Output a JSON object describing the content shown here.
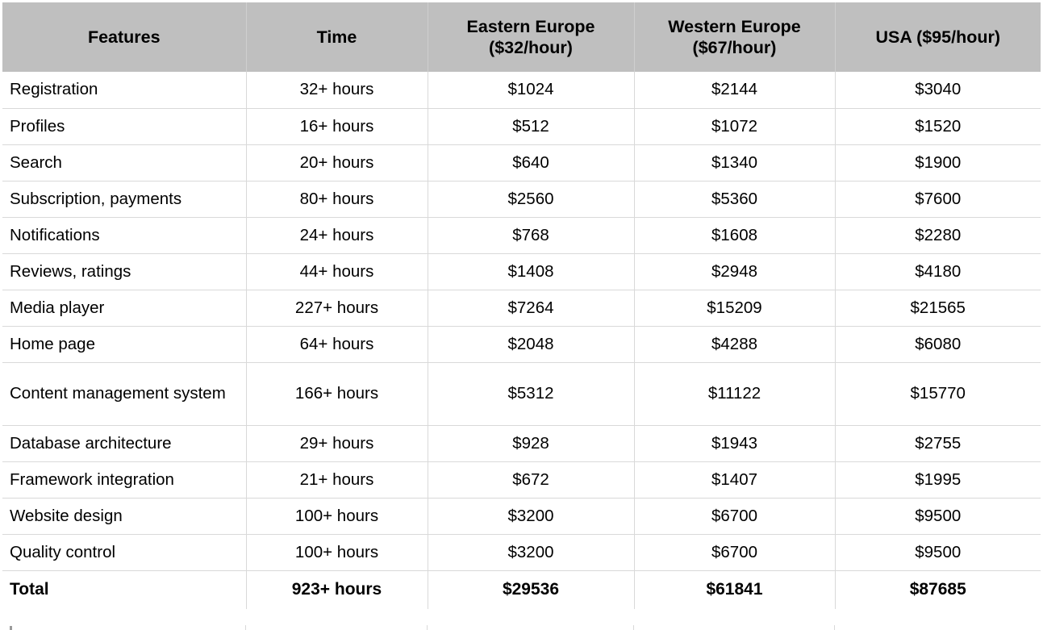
{
  "table": {
    "columns": [
      {
        "key": "feature",
        "label": "Features"
      },
      {
        "key": "time",
        "label": "Time"
      },
      {
        "key": "eastern_europe",
        "label": "Eastern Europe\n($32/hour)",
        "label_line1": "Eastern Europe",
        "label_line2": "($32/hour)"
      },
      {
        "key": "western_europe",
        "label": "Western Europe\n($67/hour)",
        "label_line1": "Western Europe",
        "label_line2": "($67/hour)"
      },
      {
        "key": "usa",
        "label": "USA ($95/hour)",
        "label_line1": "USA ($95/hour)",
        "label_line2": ""
      }
    ],
    "rows": [
      {
        "feature": "Registration",
        "time": "32+ hours",
        "eastern_europe": "$1024",
        "western_europe": "$2144",
        "usa": "$3040"
      },
      {
        "feature": "Profiles",
        "time": "16+ hours",
        "eastern_europe": "$512",
        "western_europe": "$1072",
        "usa": "$1520"
      },
      {
        "feature": "Search",
        "time": "20+ hours",
        "eastern_europe": "$640",
        "western_europe": "$1340",
        "usa": "$1900"
      },
      {
        "feature": "Subscription, payments",
        "time": "80+ hours",
        "eastern_europe": "$2560",
        "western_europe": "$5360",
        "usa": "$7600"
      },
      {
        "feature": "Notifications",
        "time": "24+ hours",
        "eastern_europe": "$768",
        "western_europe": "$1608",
        "usa": "$2280"
      },
      {
        "feature": "Reviews, ratings",
        "time": "44+ hours",
        "eastern_europe": "$1408",
        "western_europe": "$2948",
        "usa": "$4180"
      },
      {
        "feature": "Media player",
        "time": "227+ hours",
        "eastern_europe": "$7264",
        "western_europe": "$15209",
        "usa": "$21565"
      },
      {
        "feature": "Home page",
        "time": "64+ hours",
        "eastern_europe": "$2048",
        "western_europe": "$4288",
        "usa": "$6080"
      },
      {
        "feature": "Content management system",
        "time": "166+ hours",
        "eastern_europe": "$5312",
        "western_europe": "$11122",
        "usa": "$15770"
      },
      {
        "feature": "Database architecture",
        "time": "29+ hours",
        "eastern_europe": "$928",
        "western_europe": "$1943",
        "usa": "$2755"
      },
      {
        "feature": "Framework integration",
        "time": "21+ hours",
        "eastern_europe": "$672",
        "western_europe": "$1407",
        "usa": "$1995"
      },
      {
        "feature": "Website design",
        "time": "100+ hours",
        "eastern_europe": "$3200",
        "western_europe": "$6700",
        "usa": "$9500"
      },
      {
        "feature": "Quality control",
        "time": "100+ hours",
        "eastern_europe": "$3200",
        "western_europe": "$6700",
        "usa": "$9500"
      }
    ],
    "total_row": {
      "feature": "Total",
      "time": "923+ hours",
      "eastern_europe": "$29536",
      "western_europe": "$61841",
      "usa": "$87685"
    }
  },
  "colors": {
    "header_background": "#bfbfbf",
    "grid_line": "#d9d9d9",
    "text": "#000000",
    "page_background": "#ffffff"
  }
}
